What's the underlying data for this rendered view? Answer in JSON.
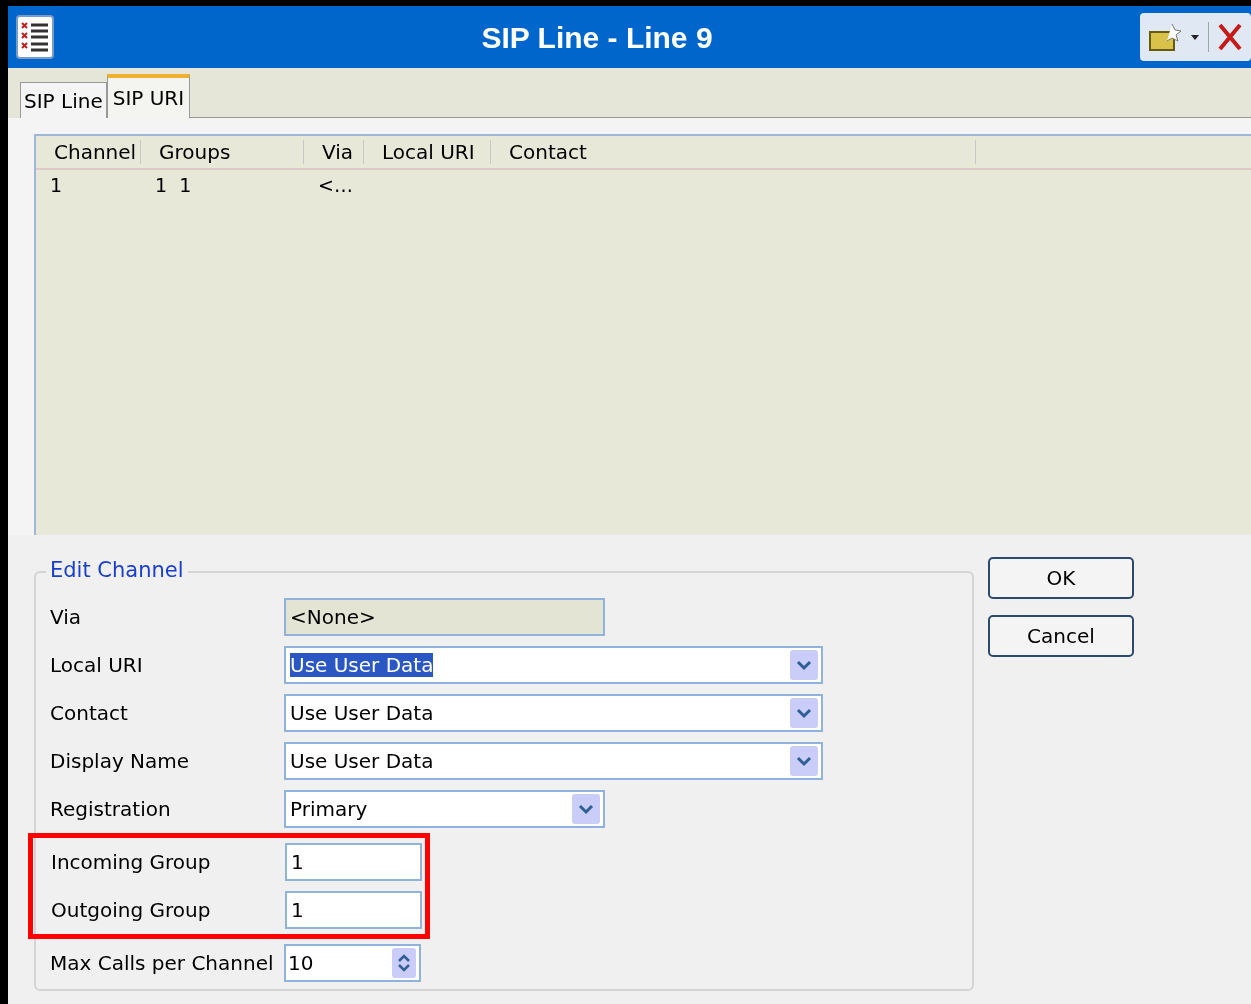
{
  "window": {
    "title": "SIP Line - Line 9"
  },
  "tabs": [
    {
      "label": "SIP Line",
      "selected": false
    },
    {
      "label": "SIP URI",
      "selected": true
    }
  ],
  "table": {
    "columns": [
      "Channel",
      "Groups",
      "Via",
      "Local URI",
      "Contact"
    ],
    "rows": [
      {
        "cells": [
          "1",
          "1  1",
          "<…"
        ]
      }
    ]
  },
  "edit_channel": {
    "title": "Edit Channel",
    "rows": [
      {
        "label": "Via",
        "kind": "readonly",
        "value": "<None>",
        "highlighted": false
      },
      {
        "label": "Local URI",
        "kind": "combo",
        "value": "Use User Data",
        "selected": true,
        "highlighted": false
      },
      {
        "label": "Contact",
        "kind": "combo",
        "value": "Use User Data",
        "selected": false,
        "highlighted": false
      },
      {
        "label": "Display Name",
        "kind": "combo",
        "value": "Use User Data",
        "selected": false,
        "highlighted": false
      },
      {
        "label": "Registration",
        "kind": "dropdown",
        "value": "Primary",
        "highlighted": false
      },
      {
        "label": "Incoming Group",
        "kind": "text",
        "value": "1",
        "highlighted": true
      },
      {
        "label": "Outgoing Group",
        "kind": "text",
        "value": "1",
        "highlighted": true
      },
      {
        "label": "Max Calls per Channel",
        "kind": "spin",
        "value": "10",
        "highlighted": false
      }
    ]
  },
  "buttons": [
    "OK",
    "Cancel"
  ]
}
